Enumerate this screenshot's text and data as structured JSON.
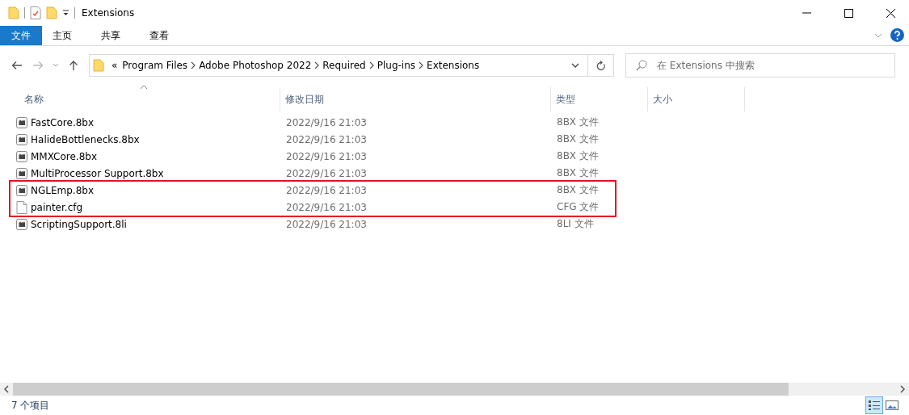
{
  "window": {
    "title": "Extensions"
  },
  "ribbon_tabs": [
    {
      "label": "文件",
      "selected": true
    },
    {
      "label": "主页",
      "selected": false
    },
    {
      "label": "共享",
      "selected": false
    },
    {
      "label": "查看",
      "selected": false
    }
  ],
  "address": {
    "overflow": "«",
    "path": [
      "Program Files",
      "Adobe Photoshop 2022",
      "Required",
      "Plug-ins",
      "Extensions"
    ]
  },
  "search": {
    "placeholder": "在 Extensions 中搜索"
  },
  "columns": [
    "名称",
    "修改日期",
    "类型",
    "大小"
  ],
  "rows": [
    {
      "kind": "plugin",
      "name": "FastCore.8bx",
      "modified": "2022/9/16 21:03",
      "type": "8BX 文件",
      "highlighted": false
    },
    {
      "kind": "plugin",
      "name": "HalideBottlenecks.8bx",
      "modified": "2022/9/16 21:03",
      "type": "8BX 文件",
      "highlighted": false
    },
    {
      "kind": "plugin",
      "name": "MMXCore.8bx",
      "modified": "2022/9/16 21:03",
      "type": "8BX 文件",
      "highlighted": false
    },
    {
      "kind": "plugin",
      "name": "MultiProcessor Support.8bx",
      "modified": "2022/9/16 21:03",
      "type": "8BX 文件",
      "highlighted": false
    },
    {
      "kind": "plugin",
      "name": "NGLEmp.8bx",
      "modified": "2022/9/16 21:03",
      "type": "8BX 文件",
      "highlighted": true
    },
    {
      "kind": "document",
      "name": "painter.cfg",
      "modified": "2022/9/16 21:03",
      "type": "CFG 文件",
      "highlighted": true
    },
    {
      "kind": "plugin",
      "name": "ScriptingSupport.8li",
      "modified": "2022/9/16 21:03",
      "type": "8LI 文件",
      "highlighted": false
    }
  ],
  "status_bar": {
    "count": "7 个项目"
  }
}
